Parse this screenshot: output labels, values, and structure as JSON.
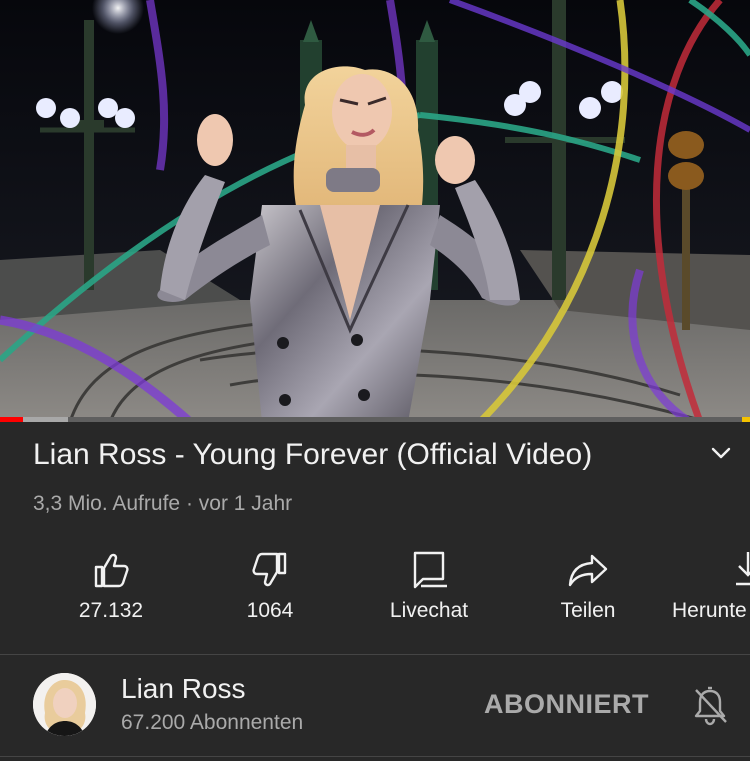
{
  "video": {
    "title": "Lian Ross - Young Forever (Official Video)",
    "views": "3,3 Mio. Aufrufe",
    "separator": "·",
    "age": "vor 1 Jahr",
    "progress_fraction": 0.03,
    "buffered_fraction": 0.09
  },
  "actions": {
    "like_count": "27.132",
    "dislike_count": "1064",
    "livechat_label": "Livechat",
    "share_label": "Teilen",
    "download_label": "Herunte"
  },
  "channel": {
    "name": "Lian Ross",
    "subscribers": "67.200 Abonnenten",
    "subscribe_label": "ABONNIERT"
  },
  "icons": {
    "expand": "chevron-down-icon",
    "like": "thumbs-up-icon",
    "dislike": "thumbs-down-icon",
    "livechat": "chat-icon",
    "share": "share-arrow-icon",
    "download": "download-icon",
    "notifications": "bell-off-icon"
  },
  "colors": {
    "background": "#282828",
    "text_primary": "#f1f1f1",
    "text_secondary": "#aaaaaa",
    "progress": "#ff0000"
  }
}
